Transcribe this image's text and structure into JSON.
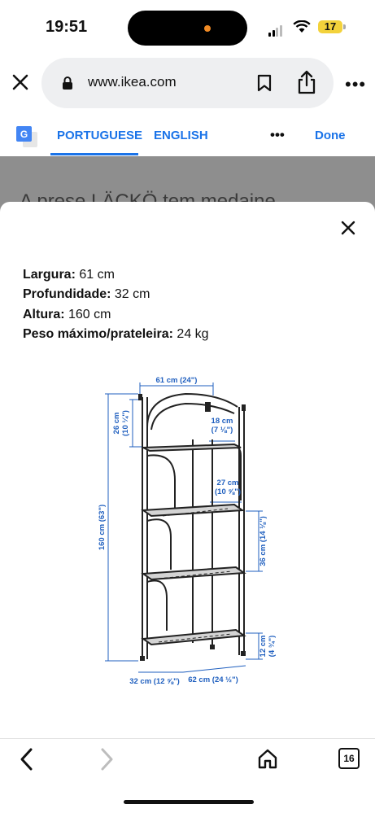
{
  "status": {
    "time": "19:51",
    "battery": "17"
  },
  "browser": {
    "url": "www.ikea.com",
    "tab_count": "16"
  },
  "translate": {
    "source_lang": "PORTUGUESE",
    "target_lang": "ENGLISH",
    "done_label": "Done"
  },
  "page": {
    "background_title": "A prese LÄCKÖ tem medaine"
  },
  "specs": [
    {
      "label": "Largura:",
      "value": " 61 cm"
    },
    {
      "label": "Profundidade:",
      "value": " 32 cm"
    },
    {
      "label": "Altura:",
      "value": " 160 cm"
    },
    {
      "label": "Peso máximo/prateleira:",
      "value": " 24 kg"
    }
  ],
  "diagram": {
    "width": "61 cm (24\")",
    "height": "160 cm (63\")",
    "top_section_cm": "26 cm",
    "top_section_in": "(10 ¼\")",
    "top_shelf_depth_cm": "18 cm",
    "top_shelf_depth_in": "(7 ⅛\")",
    "shelf_depth_cm": "27 cm",
    "shelf_depth_in": "(10 ⅝\")",
    "shelf_spacing": "36 cm (14 ⅛\")",
    "bottom_clearance_cm": "12 cm",
    "bottom_clearance_in": "(4 ¾\")",
    "depth": "32 cm (12 ⅝\")",
    "base_width": "62 cm (24 ½\")"
  },
  "colors": {
    "accent": "#1a73e8",
    "dimension_blue": "#1f5fbf",
    "dim_overlay": "#8e8e8e"
  }
}
